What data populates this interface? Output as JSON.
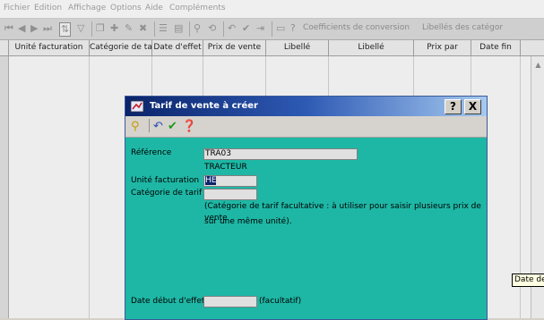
{
  "menu": [
    "Fichier",
    "Edition",
    "Affichage",
    "Options",
    "Aide",
    "Compléments"
  ],
  "toolbar": {
    "coeff_label": "Coefficients de conversion",
    "labels_label": "Libellés des catégor"
  },
  "grid": {
    "columns": [
      "Unité facturation",
      "Catégorie de tarif",
      "Date d'effet",
      "Prix de vente",
      "Libellé",
      "Libellé",
      "Prix par",
      "Date fin"
    ],
    "tooltip": "Date de"
  },
  "dialog": {
    "title": "Tarif de vente à créer",
    "help": "?",
    "close": "X",
    "fields": {
      "reference_label": "Référence",
      "reference_value": "TRA03",
      "reference_desc": "TRACTEUR",
      "unite_label": "Unité facturation",
      "unite_value": "HE",
      "categorie_label": "Catégorie de tarif",
      "categorie_value": "",
      "note_line1": "(Catégorie de tarif facultative : à utiliser pour saisir plusieurs prix de vente",
      "note_line2": "sur une même unité).",
      "date_label": "Date début d'effet",
      "date_value": "",
      "date_hint": "(facultatif)"
    }
  },
  "colors": {
    "form_bg": "#1eb7a5",
    "title_start": "#0a246a",
    "title_end": "#a6caf0"
  }
}
